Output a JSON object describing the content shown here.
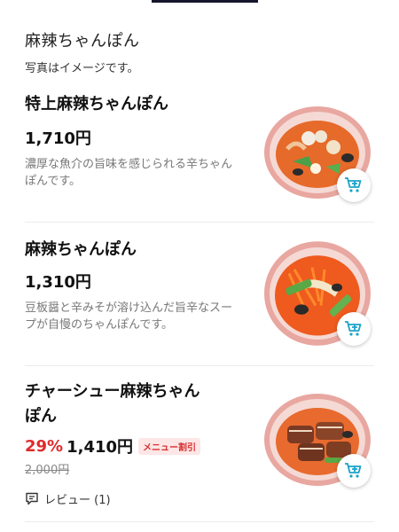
{
  "header": {
    "title": "麻辣ちゃんぽん",
    "note": "写真はイメージです。"
  },
  "items": [
    {
      "name": "特上麻辣ちゃんぽん",
      "price": "1,710円",
      "description": "濃厚な魚介の旨味を感じられる辛ちゃんぽんです。",
      "image_icon": "dish-photo-icon",
      "cart_icon": "add-to-cart-icon"
    },
    {
      "name": "麻辣ちゃんぽん",
      "price": "1,310円",
      "description": "豆板醤と辛みそが溶け込んだ旨辛なスープが自慢のちゃんぽんです。",
      "image_icon": "dish-photo-icon",
      "cart_icon": "add-to-cart-icon"
    },
    {
      "name": "チャーシュー麻辣ちゃんぽん",
      "discount": "29%",
      "price": "1,410円",
      "tag": "メニュー割引",
      "original_price": "2,000円",
      "review": "レビュー (1)",
      "image_icon": "dish-photo-icon",
      "cart_icon": "add-to-cart-icon"
    }
  ],
  "colors": {
    "accent": "#1aa3c9",
    "discount": "#e02a2a",
    "tag_bg": "#fde6e6"
  }
}
